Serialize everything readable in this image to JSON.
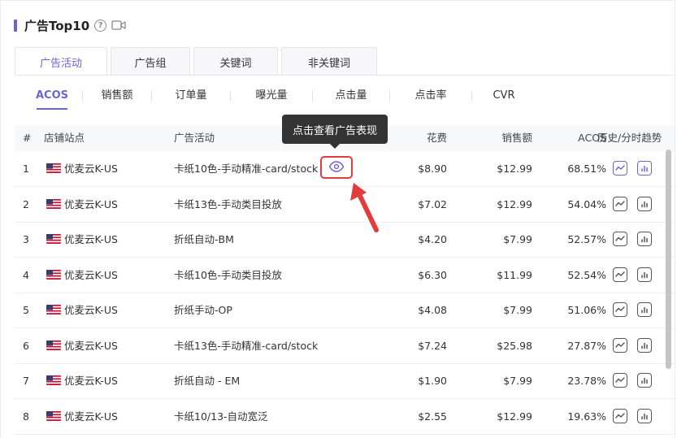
{
  "header": {
    "title": "广告Top10"
  },
  "top_tabs": [
    {
      "label": "广告活动",
      "active": true
    },
    {
      "label": "广告组",
      "active": false
    },
    {
      "label": "关键词",
      "active": false
    },
    {
      "label": "非关键词",
      "active": false
    }
  ],
  "metric_tabs": [
    {
      "label": "ACOS",
      "active": true
    },
    {
      "label": "销售额",
      "active": false
    },
    {
      "label": "订单量",
      "active": false
    },
    {
      "label": "曝光量",
      "active": false
    },
    {
      "label": "点击量",
      "active": false
    },
    {
      "label": "点击率",
      "active": false
    },
    {
      "label": "CVR",
      "active": false
    }
  ],
  "table": {
    "columns": {
      "index": "#",
      "store": "店铺站点",
      "campaign": "广告活动",
      "spend": "花费",
      "sales": "销售额",
      "acos": "ACOS",
      "trend": "历史/分时趋势"
    },
    "rows": [
      {
        "index": "1",
        "store": "优麦云K-US",
        "campaign": "卡纸10色-手动精准-card/stock",
        "spend": "$8.90",
        "sales": "$12.99",
        "acos": "68.51%"
      },
      {
        "index": "2",
        "store": "优麦云K-US",
        "campaign": "卡纸13色-手动类目投放",
        "spend": "$7.02",
        "sales": "$12.99",
        "acos": "54.04%"
      },
      {
        "index": "3",
        "store": "优麦云K-US",
        "campaign": "折纸自动-BM",
        "spend": "$4.20",
        "sales": "$7.99",
        "acos": "52.57%"
      },
      {
        "index": "4",
        "store": "优麦云K-US",
        "campaign": "卡纸10色-手动类目投放",
        "spend": "$6.30",
        "sales": "$11.99",
        "acos": "52.54%"
      },
      {
        "index": "5",
        "store": "优麦云K-US",
        "campaign": "折纸手动-OP",
        "spend": "$4.08",
        "sales": "$7.99",
        "acos": "51.06%"
      },
      {
        "index": "6",
        "store": "优麦云K-US",
        "campaign": "卡纸13色-手动精准-card/stock",
        "spend": "$7.24",
        "sales": "$25.98",
        "acos": "27.87%"
      },
      {
        "index": "7",
        "store": "优麦云K-US",
        "campaign": "折纸自动 - EM",
        "spend": "$1.90",
        "sales": "$7.99",
        "acos": "23.78%"
      },
      {
        "index": "8",
        "store": "优麦云K-US",
        "campaign": "卡纸10/13-自动宽泛",
        "spend": "$2.55",
        "sales": "$12.99",
        "acos": "19.63%"
      }
    ]
  },
  "tooltip": {
    "text": "点击查看广告表现"
  },
  "icons": {
    "help": "help-icon",
    "video": "video-icon",
    "eye": "eye-icon",
    "flag": "us-flag-icon",
    "trend_history": "line-trend-icon",
    "trend_hourly": "bar-trend-icon"
  },
  "colors": {
    "accent": "#6b63d8",
    "highlight": "#e43b3b",
    "tooltip_bg": "#333333"
  }
}
